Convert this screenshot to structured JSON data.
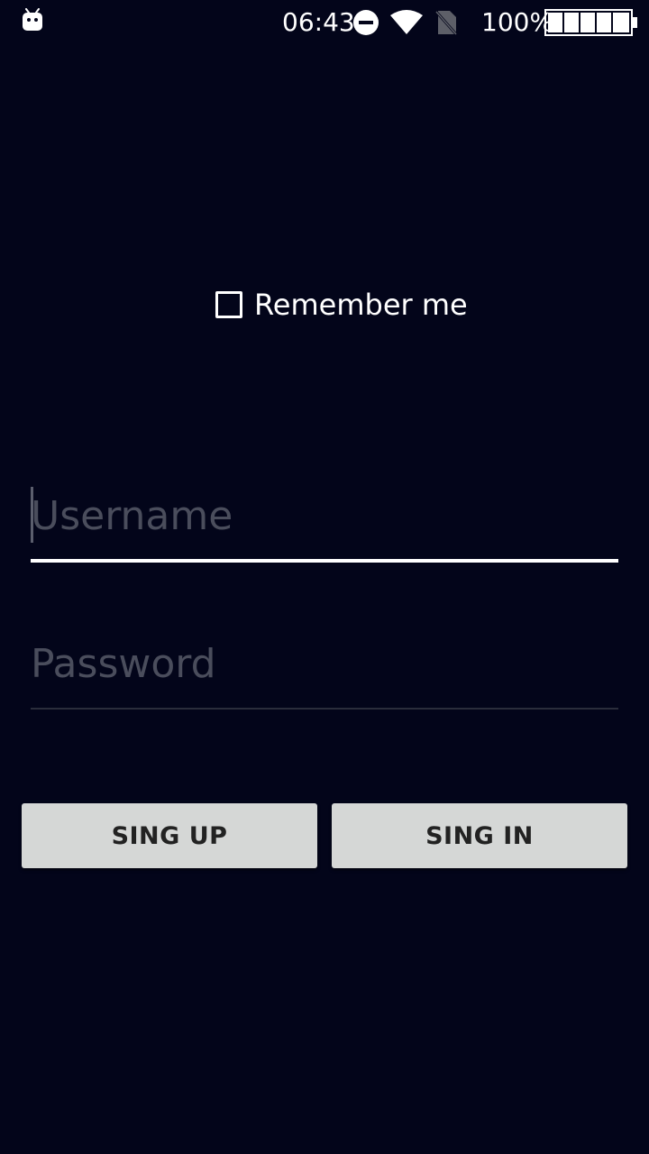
{
  "status_bar": {
    "time": "06:43",
    "battery_percent": "100%",
    "icons": [
      "android-icon",
      "do-not-disturb-icon",
      "wifi-icon",
      "no-sim-icon",
      "battery-icon"
    ],
    "battery_level": 1.0
  },
  "form": {
    "remember_label": "Remember me",
    "remember_checked": false,
    "username_placeholder": "Username",
    "password_placeholder": "Password",
    "signup_label": "SING UP",
    "signin_label": "SING IN"
  },
  "colors": {
    "background": "#03051a",
    "button_bg": "#d5d7d6",
    "button_text": "#222222",
    "placeholder": "#4a4d5c",
    "focused_underline": "#ffffff"
  }
}
